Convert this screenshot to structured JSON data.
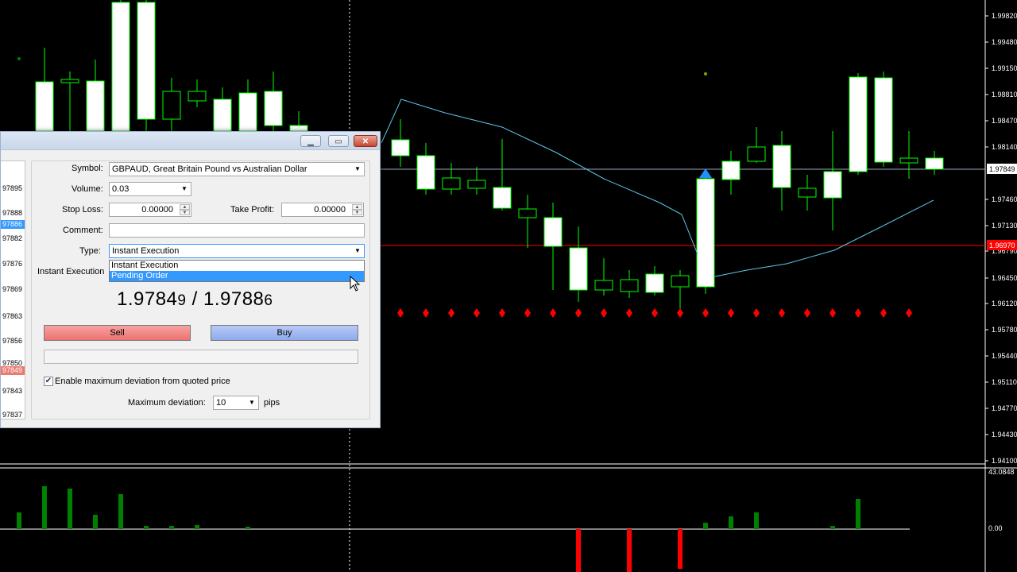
{
  "dialog": {
    "title": "",
    "controls": {
      "minimize": "▁",
      "maximize": "▭",
      "close": "✕"
    },
    "symbol_label": "Symbol:",
    "symbol_value": "GBPAUD, Great Britain Pound vs Australian Dollar",
    "volume_label": "Volume:",
    "volume_value": "0.03",
    "stop_loss_label": "Stop Loss:",
    "stop_loss_value": "0.00000",
    "take_profit_label": "Take Profit:",
    "take_profit_value": "0.00000",
    "comment_label": "Comment:",
    "comment_value": "",
    "type_label": "Type:",
    "type_value": "Instant Execution",
    "type_options": [
      "Instant Execution",
      "Pending Order"
    ],
    "highlighted_option": "Pending Order",
    "section_label": "Instant Execution",
    "bid_main": "1.9784",
    "bid_pip": "9",
    "separator": " / ",
    "ask_main": "1.9788",
    "ask_pip": "6",
    "sell_label": "Sell",
    "buy_label": "Buy",
    "deviation_checkbox_label": "Enable maximum deviation from quoted price",
    "deviation_checked": true,
    "max_deviation_label": "Maximum deviation:",
    "max_deviation_value": "10",
    "pips_label": "pips",
    "quotes": [
      "97895",
      "97888",
      "97886",
      "97882",
      "97876",
      "97869",
      "97863",
      "97856",
      "97850",
      "97849",
      "97843",
      "97837"
    ],
    "selected_quote": "97886",
    "red_quote": "97849"
  },
  "price_axis": {
    "labels": [
      "1.99820",
      "1.99480",
      "1.99150",
      "1.98810",
      "1.98470",
      "1.98140",
      "1.97849",
      "1.97460",
      "1.97130",
      "1.96790",
      "1.96450",
      "1.96120",
      "1.95780",
      "1.95440",
      "1.95110",
      "1.94770",
      "1.94430",
      "1.94100"
    ],
    "current_price": "1.97849",
    "red_line_label": "1.96970"
  },
  "indicator_axis": {
    "top": "43.0848",
    "zero": "0.00"
  },
  "colors": {
    "background": "#000000",
    "bull_candle_fill": "#ffffff",
    "candle_outline": "#00ff00",
    "moving_average": "#5ac8e6",
    "red_level": "#ff0000",
    "histogram_up": "#008000",
    "histogram_down": "#ff0000",
    "arrow_marker": "#1e90ff"
  }
}
